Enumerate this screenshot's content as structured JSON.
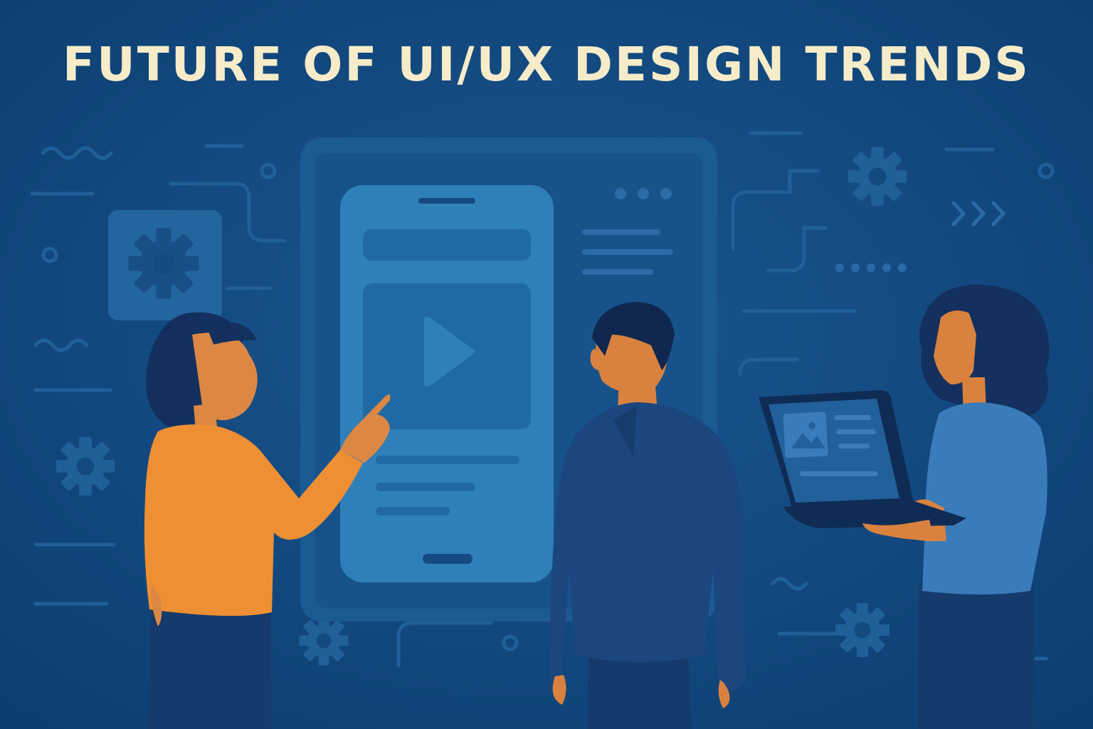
{
  "banner": {
    "title": "FUTURE OF UI/UX DESIGN TRENDS"
  },
  "colors": {
    "background": "#0e4478",
    "title_text": "#f6ecc9",
    "accent_orange": "#ee8f34",
    "phone_screen": "#2f80b8",
    "navy_suit": "#173e72",
    "sweater_blue": "#3a7cb9"
  },
  "icons": [
    "gear-icon",
    "play-icon",
    "image-icon",
    "chevron-right-icon",
    "dots-icon",
    "squiggle-icon"
  ],
  "people": [
    "woman-pointing",
    "man-in-suit",
    "woman-with-laptop"
  ]
}
